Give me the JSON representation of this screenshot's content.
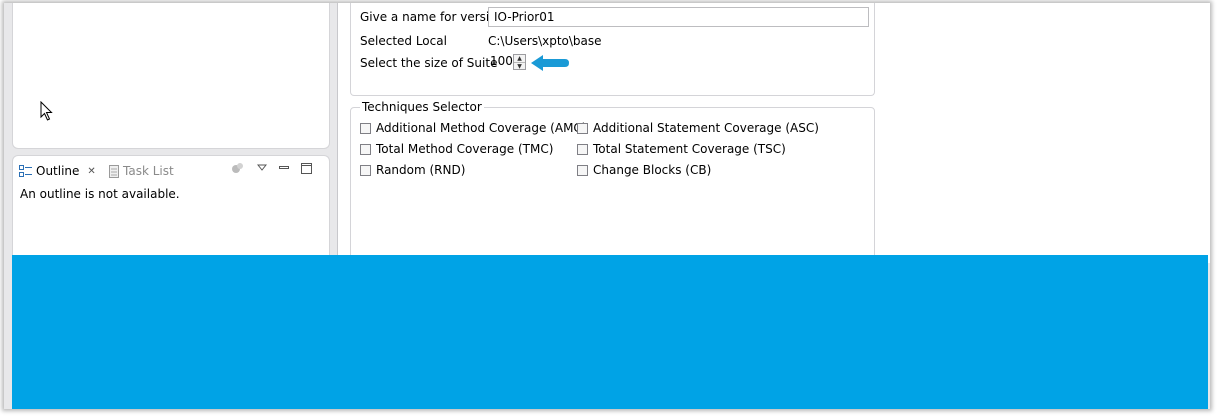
{
  "outline_view": {
    "tabs": [
      {
        "label": "Outline",
        "icon": "outline-icon",
        "active": true
      },
      {
        "label": "Task List",
        "icon": "task-list-icon",
        "active": false
      }
    ],
    "message": "An outline is not available."
  },
  "form": {
    "version_name_label": "Give a name for version",
    "version_name_value": "IO-Prior01",
    "selected_local_label": "Selected Local",
    "selected_local_value": "C:\\Users\\xpto\\base",
    "suite_size_label": "Select the size of Suite",
    "suite_size_value": "100"
  },
  "techniques": {
    "legend": "Techniques Selector",
    "options": [
      {
        "label": "Additional Method Coverage (AMC)",
        "checked": false
      },
      {
        "label": "Additional Statement Coverage (ASC)",
        "checked": false
      },
      {
        "label": "Total Method Coverage (TMC)",
        "checked": false
      },
      {
        "label": "Total Statement Coverage (TSC)",
        "checked": false
      },
      {
        "label": "Random (RND)",
        "checked": false
      },
      {
        "label": "Change Blocks (CB)",
        "checked": false
      }
    ]
  },
  "colors": {
    "banner": "#00a3e6",
    "annotation_arrow": "#1a9ad6"
  }
}
